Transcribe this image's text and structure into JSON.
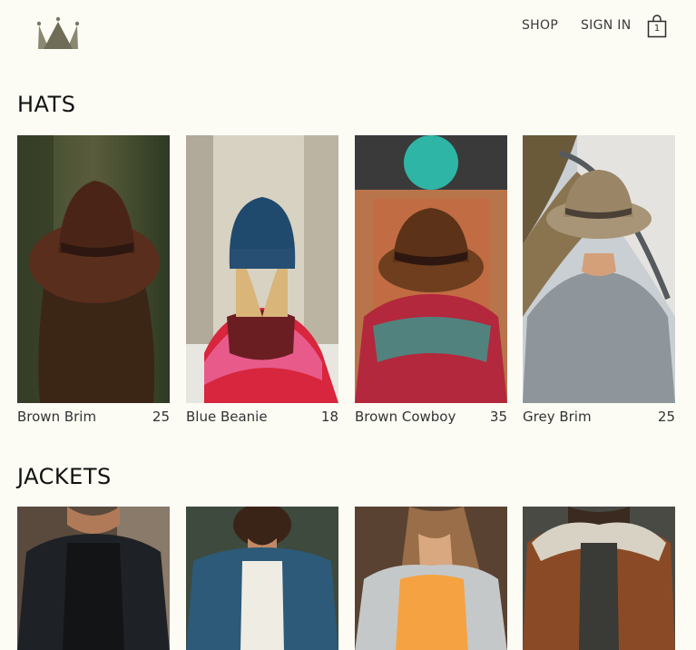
{
  "header": {
    "logo_icon": "crown-icon",
    "nav": {
      "shop_label": "SHOP",
      "signin_label": "SIGN IN"
    },
    "cart": {
      "icon": "shopping-bag-icon",
      "count": "1"
    }
  },
  "sections": [
    {
      "title": "HATS",
      "items": [
        {
          "name": "Brown Brim",
          "price": "25"
        },
        {
          "name": "Blue Beanie",
          "price": "18"
        },
        {
          "name": "Brown Cowboy",
          "price": "35"
        },
        {
          "name": "Grey Brim",
          "price": "25"
        }
      ]
    },
    {
      "title": "JACKETS",
      "items": [
        {
          "name": "",
          "price": ""
        },
        {
          "name": "",
          "price": ""
        },
        {
          "name": "",
          "price": ""
        },
        {
          "name": "",
          "price": ""
        }
      ]
    }
  ],
  "colors": {
    "background": "#fcfcf5",
    "logo": "#7a7864"
  }
}
